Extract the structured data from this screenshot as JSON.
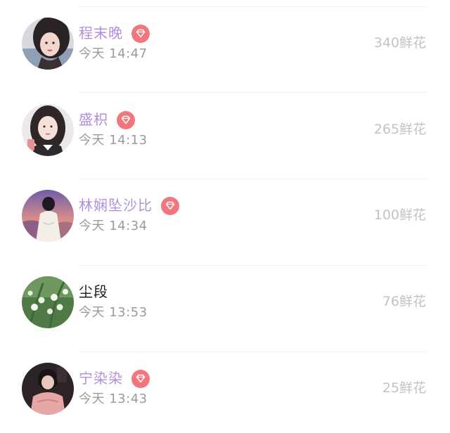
{
  "colors": {
    "vip_name": "#b28fdc",
    "normal_name": "#1c1c1e",
    "time": "#9b9b9f",
    "flowers": "#c3c3c7",
    "badge": "#f1767d",
    "divider": "#efeff2"
  },
  "entries": [
    {
      "name": "程末晚",
      "vip": true,
      "time": "今天 14:47",
      "flowers": "340鲜花",
      "avatar_icon": "avatar-photo-icon",
      "badge_icon": "diamond-icon"
    },
    {
      "name": "盛枳",
      "vip": true,
      "time": "今天 14:13",
      "flowers": "265鲜花",
      "avatar_icon": "avatar-photo-icon",
      "badge_icon": "diamond-icon"
    },
    {
      "name": "林娴坠沙比",
      "vip": true,
      "time": "今天 14:34",
      "flowers": "100鲜花",
      "avatar_icon": "avatar-illustration-icon",
      "badge_icon": "diamond-icon"
    },
    {
      "name": "尘段",
      "vip": false,
      "time": "今天 13:53",
      "flowers": "76鲜花",
      "avatar_icon": "avatar-flowers-icon"
    },
    {
      "name": "宁染染",
      "vip": true,
      "time": "今天 13:43",
      "flowers": "25鲜花",
      "avatar_icon": "avatar-illustration-icon",
      "badge_icon": "diamond-icon"
    }
  ]
}
